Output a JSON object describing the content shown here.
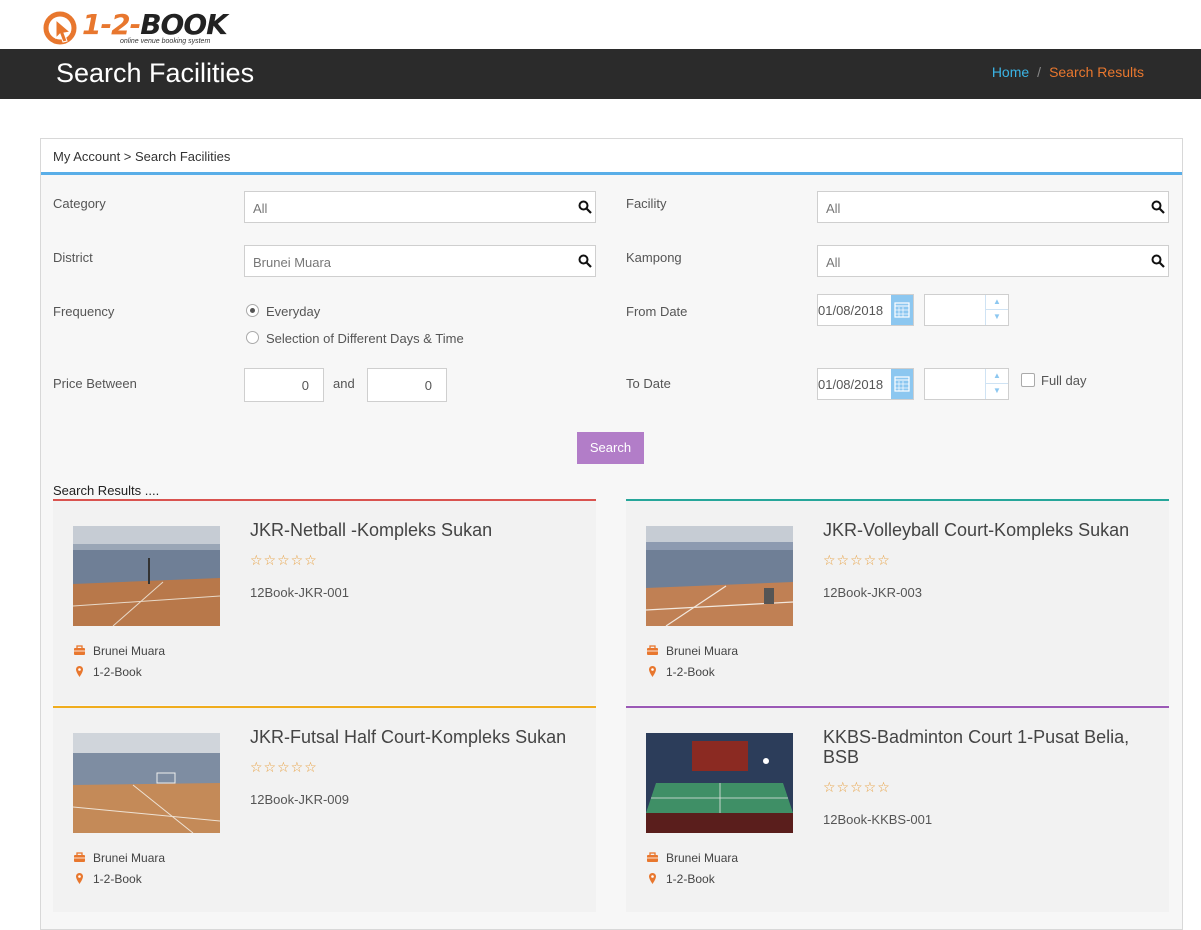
{
  "brand": {
    "logo_text_a": "1-2-",
    "logo_text_b": "BOOK",
    "tagline": "online venue booking system"
  },
  "header": {
    "title": "Search Facilities",
    "breadcrumb_home": "Home",
    "breadcrumb_sep": "/",
    "breadcrumb_current": "Search Results"
  },
  "panel": {
    "heading": "My Account > Search Facilities"
  },
  "form": {
    "category_label": "Category",
    "category_value": "All",
    "facility_label": "Facility",
    "facility_value": "All",
    "district_label": "District",
    "district_value": "Brunei Muara",
    "kampong_label": "Kampong",
    "kampong_value": "All",
    "frequency_label": "Frequency",
    "frequency_options": [
      "Everyday",
      "Selection of Different Days & Time"
    ],
    "frequency_selected": "Everyday",
    "price_label": "Price Between",
    "price_min": "0",
    "price_and": "and",
    "price_max": "0",
    "from_date_label": "From Date",
    "from_date": "01/08/2018",
    "from_time": "",
    "to_date_label": "To Date",
    "to_date": "01/08/2018",
    "to_time": "",
    "full_day_label": "Full day",
    "full_day_checked": false,
    "search_label": "Search"
  },
  "results": {
    "title": "Search Results ....",
    "items": [
      {
        "name": "JKR-Netball -Kompleks Sukan",
        "rating": 0,
        "stars": "☆☆☆☆☆",
        "code": "12Book-JKR-001",
        "district": "Brunei Muara",
        "location": "1-2-Book",
        "accent": "#d9534f"
      },
      {
        "name": "JKR-Volleyball Court-Kompleks Sukan",
        "rating": 0,
        "stars": "☆☆☆☆☆",
        "code": "12Book-JKR-003",
        "district": "Brunei Muara",
        "location": "1-2-Book",
        "accent": "#26a69a"
      },
      {
        "name": "JKR-Futsal Half Court-Kompleks Sukan",
        "rating": 0,
        "stars": "☆☆☆☆☆",
        "code": "12Book-JKR-009",
        "district": "Brunei Muara",
        "location": "1-2-Book",
        "accent": "#f0ad1e"
      },
      {
        "name": "KKBS-Badminton Court 1-Pusat Belia, BSB",
        "rating": 0,
        "stars": "☆☆☆☆☆",
        "code": "12Book-KKBS-001",
        "district": "Brunei Muara",
        "location": "1-2-Book",
        "accent": "#9b59b6"
      }
    ]
  },
  "colors": {
    "header_bg": "#2b2b2b",
    "accent_blue": "#59aee8",
    "search_button": "#b27dc8",
    "orange": "#e8772e"
  }
}
